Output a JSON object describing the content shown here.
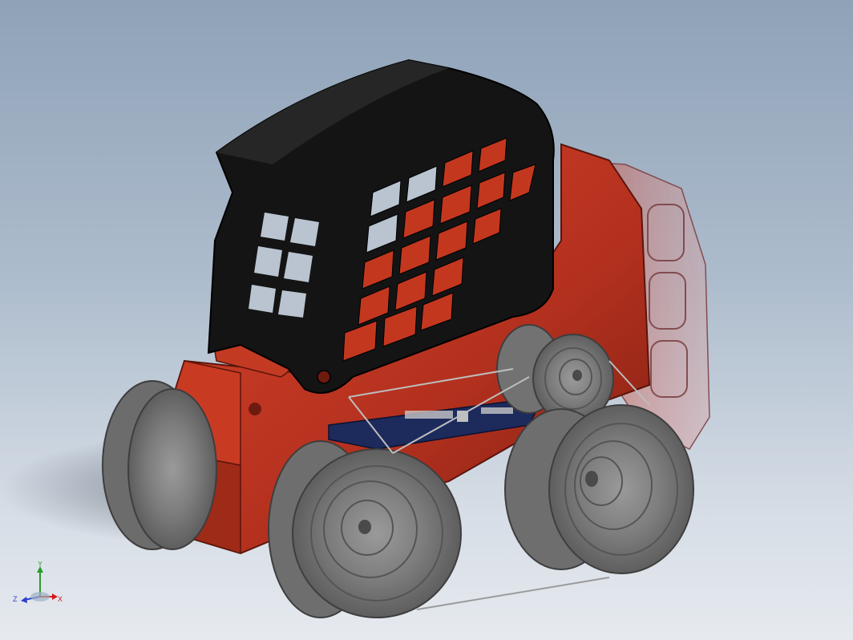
{
  "triad": {
    "x_label": "X",
    "y_label": "Y",
    "z_label": "Z"
  },
  "colors": {
    "body_red": "#b8321f",
    "cab_black": "#121212",
    "tire_grey": "#8d8d8d",
    "board_blue": "#1d2a5c",
    "axis_x": "#d11a1a",
    "axis_y": "#2a9a2a",
    "axis_z": "#2a3fd1"
  }
}
